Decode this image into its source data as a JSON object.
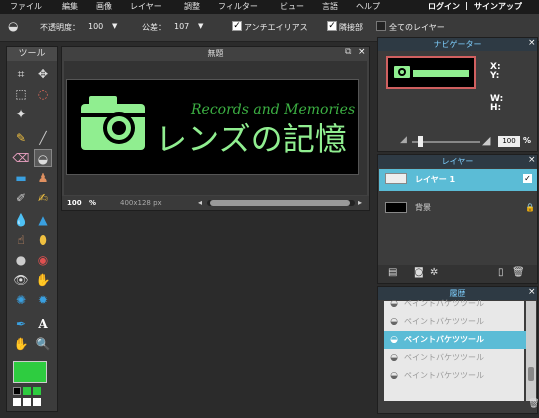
{
  "menubar": {
    "items": [
      "ファイル",
      "編集",
      "画像",
      "レイヤー",
      "調整",
      "フィルター",
      "ビュー",
      "言語",
      "ヘルプ"
    ],
    "login": "ログイン",
    "separator": "|",
    "signup": "サインアップ"
  },
  "options": {
    "opacity_label": "不透明度：",
    "opacity_value": "100",
    "tolerance_label": "公差：",
    "tolerance_value": "107",
    "antialias_label": "アンチエイリアス",
    "antialias_checked": true,
    "contiguous_label": "隣接部",
    "contiguous_checked": true,
    "all_layers_label": "全てのレイヤー",
    "all_layers_checked": false
  },
  "tools": {
    "title": "ツール",
    "primary_color": "#2ecc40",
    "secondary_color": "#ffffff"
  },
  "document": {
    "title": "無題",
    "zoom": "100",
    "zoom_unit": "%",
    "size": "400x128 px",
    "artwork": {
      "main_text": "レンズの記憶",
      "script_text": "Records and Memories",
      "main_color": "#90ee90",
      "script_color": "#3cb043",
      "background": "#000000"
    }
  },
  "navigator": {
    "title": "ナビゲーター",
    "x_label": "X:",
    "y_label": "Y:",
    "w_label": "W:",
    "h_label": "H:",
    "zoom_value": "100",
    "zoom_unit": "%"
  },
  "layers": {
    "title": "レイヤー",
    "items": [
      {
        "name": "レイヤー 1",
        "selected": true
      },
      {
        "name": "背景",
        "selected": false
      }
    ]
  },
  "history": {
    "title": "履歴",
    "items": [
      {
        "label": "ペイントバケツツール",
        "selected": false
      },
      {
        "label": "ペイントバケツツール",
        "selected": false
      },
      {
        "label": "ペイントバケツツール",
        "selected": true
      },
      {
        "label": "ペイントバケツツール",
        "selected": false
      },
      {
        "label": "ペイントバケツツール",
        "selected": false
      }
    ]
  }
}
